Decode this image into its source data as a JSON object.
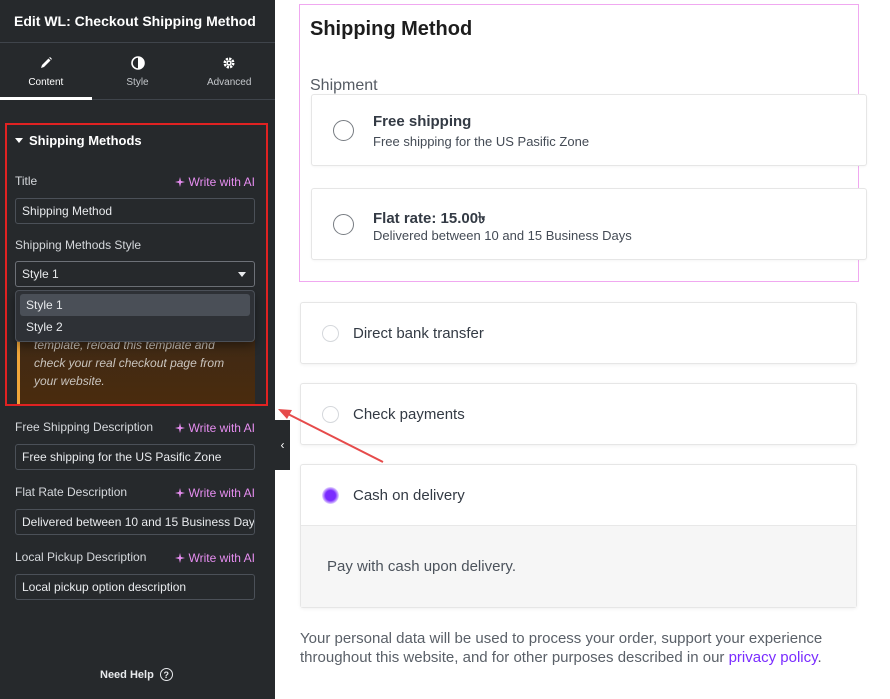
{
  "panel": {
    "title": "Edit WL: Checkout Shipping Method",
    "tabs": [
      {
        "label": "Content",
        "icon": "pencil-icon"
      },
      {
        "label": "Style",
        "icon": "contrast-icon"
      },
      {
        "label": "Advanced",
        "icon": "gear-icon"
      }
    ],
    "section_title": "Shipping Methods",
    "ai_label": "Write with AI",
    "title_label": "Title",
    "title_value": "Shipping Method",
    "style_label": "Shipping Methods Style",
    "style_value": "Style 1",
    "style_options": [
      "Style 1",
      "Style 2"
    ],
    "notice_text": "template, reload this template and check your real checkout page from your website.",
    "free_desc_label": "Free Shipping Description",
    "free_desc_value": "Free shipping for the US Pasific Zone",
    "flat_desc_label": "Flat Rate Description",
    "flat_desc_value": "Delivered between 10 and 15 Business Days",
    "pickup_desc_label": "Local Pickup Description",
    "pickup_desc_value": "Local pickup option description",
    "collapse_glyph": "‹",
    "help_label": "Need Help",
    "help_glyph": "?"
  },
  "preview": {
    "heading": "Shipping Method",
    "shipment_label": "Shipment",
    "shipping_options": [
      {
        "title": "Free shipping",
        "desc": "Free shipping for the US Pasific Zone"
      },
      {
        "title": "Flat rate: 15.00৳",
        "desc": "Delivered between 10 and 15 Business Days"
      }
    ],
    "payments": [
      {
        "label": "Direct bank transfer",
        "selected": false
      },
      {
        "label": "Check payments",
        "selected": false
      },
      {
        "label": "Cash on delivery",
        "selected": true
      }
    ],
    "cod_desc": "Pay with cash upon delivery.",
    "privacy_text": "Your personal data will be used to process your order, support your experience throughout this website, and for other purposes described in our ",
    "privacy_link": "privacy policy",
    "privacy_end": "."
  },
  "colors": {
    "panel_bg": "#26292c",
    "ai_accent": "#e68df0",
    "highlight_border": "#e02222",
    "notice_accent": "#f0a63a",
    "brand_purple": "#7a2cff",
    "arrow": "#e64b4b"
  }
}
